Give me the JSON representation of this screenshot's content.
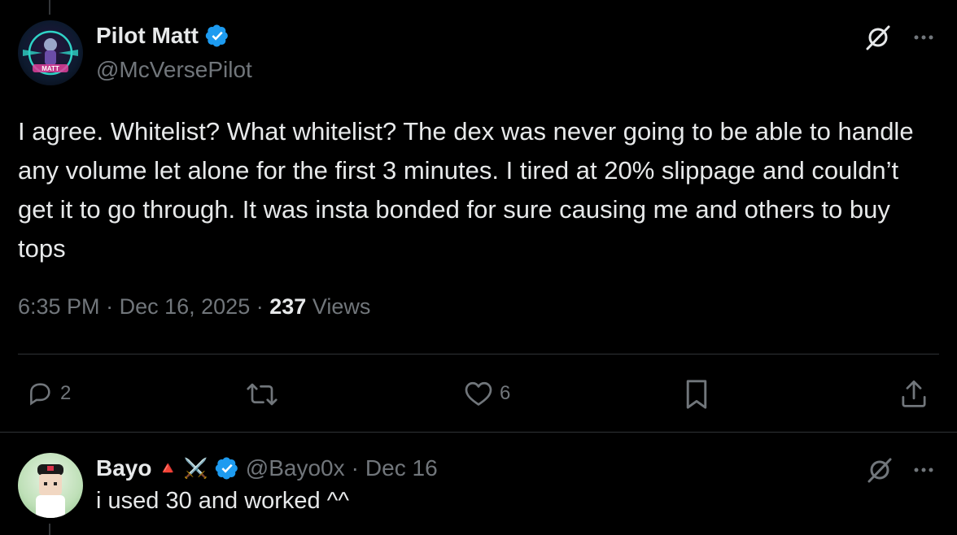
{
  "tweet": {
    "author_name": "Pilot Matt",
    "author_handle": "@McVersePilot",
    "avatar_text": "MATT",
    "text": "I agree. Whitelist? What whitelist? The dex was never going to be able to handle any volume let alone for the first 3 minutes. I tired at 20% slippage and couldn’t get it to go through. It was insta bonded for sure causing me and others to buy tops",
    "time": "6:35 PM",
    "separator": "·",
    "date": "Dec 16, 2025",
    "views_count": "237",
    "views_label": "Views",
    "replies_count": "2",
    "likes_count": "6"
  },
  "reply": {
    "author_name": "Bayo",
    "emoji_triangle": "🔺",
    "emoji_swords": "⚔️",
    "author_handle": "@Bayo0x",
    "separator": "·",
    "date": "Dec 16",
    "text": "i used 30 and worked ^^"
  },
  "colors": {
    "background": "#000000",
    "text_primary": "#e7e9ea",
    "text_secondary": "#71767b",
    "verified_blue": "#1d9bf0",
    "divider": "#2f3336"
  },
  "icons": [
    "verified-badge-icon",
    "grok-icon",
    "more-icon",
    "reply-icon",
    "retweet-icon",
    "like-icon",
    "bookmark-icon",
    "share-icon"
  ]
}
